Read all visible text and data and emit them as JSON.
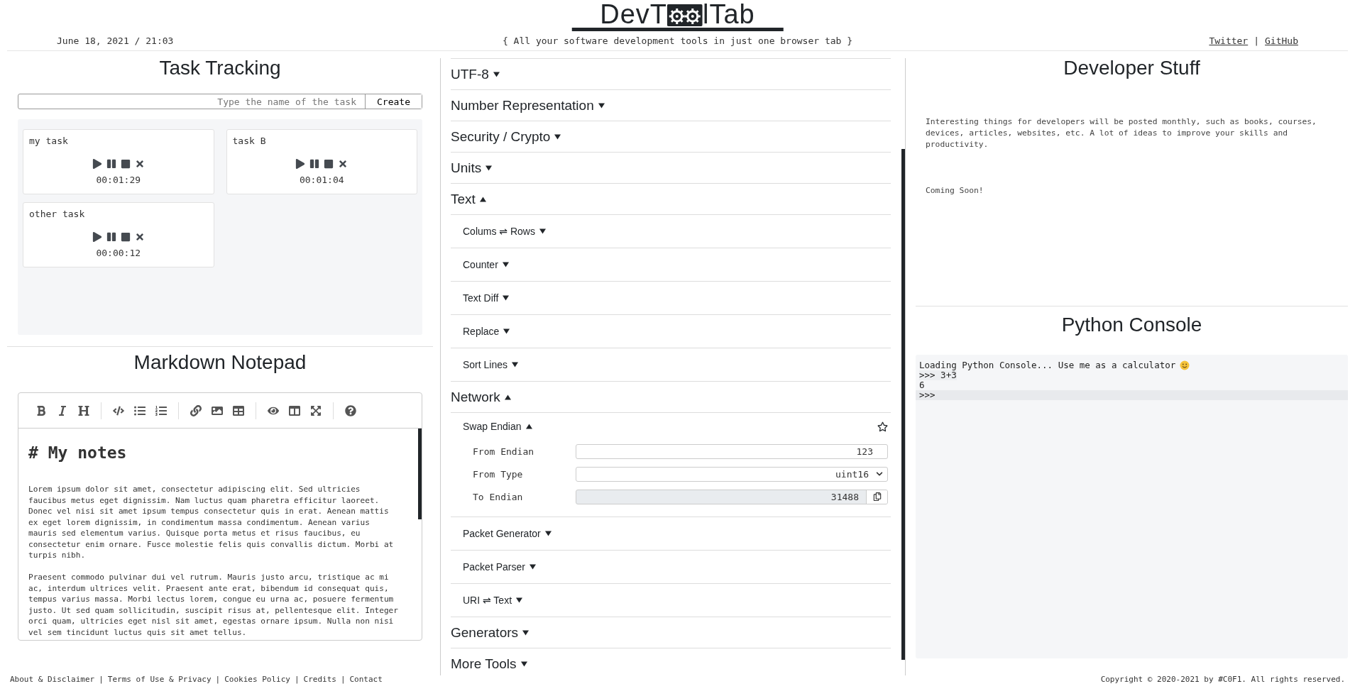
{
  "header": {
    "datetime": "June 18, 2021 / 21:03",
    "logo": {
      "before": "DevT",
      "after": "lTab"
    },
    "tagline": "{ All your software development tools in just one browser tab }",
    "links": [
      "Twitter",
      "GitHub"
    ],
    "separator": "|"
  },
  "tasks": {
    "title": "Task Tracking",
    "input": {
      "placeholder": "Type the name of the task"
    },
    "button": "Create",
    "items": [
      {
        "name": "my task",
        "time": "00:01:29"
      },
      {
        "name": "task B",
        "time": "00:01:04"
      },
      {
        "name": "other task",
        "time": "00:00:12"
      }
    ]
  },
  "notepad": {
    "title": "Markdown Notepad",
    "heading": "# My notes",
    "paragraphs": [
      "Lorem ipsum dolor sit amet, consectetur adipiscing elit. Sed ultricies faucibus metus eget dignissim. Nam luctus quam pharetra efficitur laoreet. Donec vel nisi sit amet ipsum tempus consectetur quis in erat. Aenean mattis ex eget lorem dignissim, in condimentum massa condimentum. Aenean varius mauris sed elementum varius. Quisque porta metus et risus faucibus, eu consectetur enim ornare. Fusce molestie felis quis convallis dictum. Morbi at turpis nibh.",
      "Praesent commodo pulvinar dui vel rutrum. Mauris justo arcu, tristique ac mi ac, interdum ultrices velit. Praesent ante erat, bibendum id consequat quis, tempus varius massa. Morbi lectus lorem, congue eu urna ac, posuere fermentum justo. Ut sed quam sollicitudin, suscipit risus at, pellentesque elit. Integer orci quam, ultricies eget nisl sit amet, egestas ornare ipsum. Nulla non nisi vel sem tincidunt luctus quis sit amet tellus."
    ]
  },
  "tools": {
    "sections": [
      {
        "title": "UTF-8",
        "expanded": false
      },
      {
        "title": "Number Representation",
        "expanded": false
      },
      {
        "title": "Security / Crypto",
        "expanded": false
      },
      {
        "title": "Units",
        "expanded": false
      },
      {
        "title": "Text",
        "expanded": true,
        "children": [
          {
            "title": "Colums ⇌ Rows",
            "expanded": false
          },
          {
            "title": "Counter",
            "expanded": false
          },
          {
            "title": "Text Diff",
            "expanded": false
          },
          {
            "title": "Replace",
            "expanded": false
          },
          {
            "title": "Sort Lines",
            "expanded": false
          }
        ]
      },
      {
        "title": "Network",
        "expanded": true,
        "children": [
          {
            "title": "Swap Endian",
            "expanded": true,
            "favorite": false,
            "fields": [
              {
                "label": "From Endian",
                "kind": "input",
                "value": "123"
              },
              {
                "label": "From Type",
                "kind": "select",
                "value": "uint16"
              },
              {
                "label": "To Endian",
                "kind": "output",
                "value": "31488"
              }
            ]
          },
          {
            "title": "Packet Generator",
            "expanded": false
          },
          {
            "title": "Packet Parser",
            "expanded": false
          },
          {
            "title": "URI ⇌ Text",
            "expanded": false
          }
        ]
      },
      {
        "title": "Generators",
        "expanded": false
      },
      {
        "title": "More Tools",
        "expanded": false
      }
    ]
  },
  "developer": {
    "title": "Developer Stuff",
    "text": "Interesting things for developers will be posted monthly, such as books, courses, devices, articles, websites, etc. A lot of ideas to improve your skills and productivity.",
    "note": "Coming Soon!"
  },
  "console": {
    "title": "Python Console",
    "lines": [
      {
        "kind": "output",
        "text": "Loading Python Console... Use me as a calculator",
        "emoji": true
      },
      {
        "kind": "input",
        "text": ">>> 3+3"
      },
      {
        "kind": "output",
        "text": "6"
      },
      {
        "kind": "prompt",
        "text": ">>>"
      }
    ]
  },
  "footer": {
    "links": [
      "About & Disclaimer",
      "Terms of Use & Privacy",
      "Cookies Policy",
      "Credits",
      "Contact"
    ],
    "separator": "|",
    "copyright": "Copyright © 2020-2021 by #C0F1. All rights reserved."
  }
}
